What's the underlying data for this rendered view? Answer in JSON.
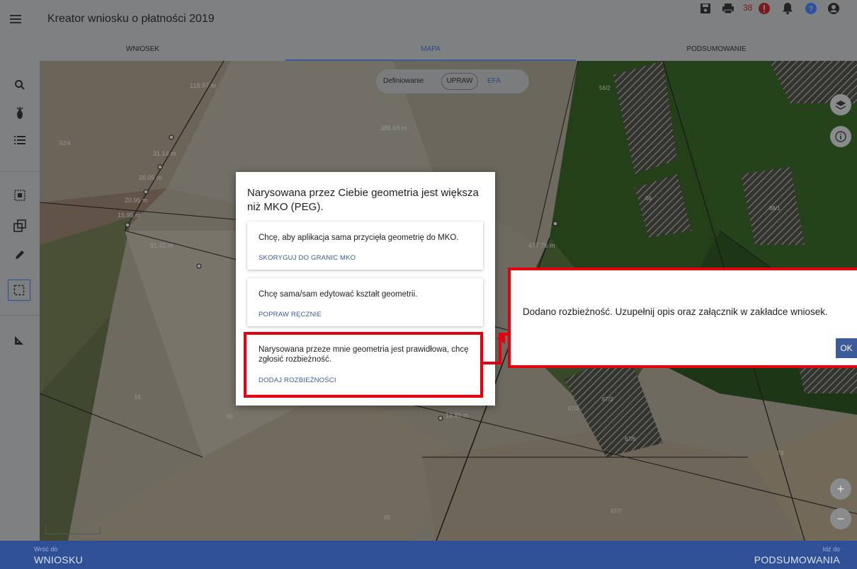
{
  "header": {
    "title": "Kreator wniosku o płatności 2019",
    "error_count": "38",
    "icons": [
      "menu-icon",
      "save-icon",
      "print-icon",
      "error-icon",
      "bell-icon",
      "help-icon",
      "account-icon"
    ]
  },
  "tabs": [
    {
      "label": "WNIOSEK"
    },
    {
      "label": "MAPA"
    },
    {
      "label": "PODSUMOWANIE"
    }
  ],
  "sidebar": {
    "icons": [
      "search-icon",
      "crop-icon",
      "list-icon",
      "select-area-icon",
      "copy-shape-icon",
      "pencil-icon",
      "selection-frame-icon",
      "measure-icon"
    ]
  },
  "map": {
    "mode_toggle": {
      "label": "Definiowanie",
      "option_1": "UPRAW",
      "option_2": "EFA"
    },
    "parcel_labels": [
      "52/4",
      "56/2",
      "66",
      "88/1",
      "67/3",
      "67/2",
      "67/6",
      "67/7",
      "55",
      "60",
      "65",
      "73"
    ],
    "measurements": [
      "118.97 m",
      "31.14 m",
      "26.05 m",
      "20.95 m",
      "15.95 m",
      "81.41 m",
      "386.69 m",
      "477.76 m",
      "13.95 m"
    ],
    "scale": "50 m",
    "zoom_in": "+",
    "zoom_out": "−"
  },
  "dialog": {
    "title": "Narysowana przez Ciebie geometria jest większa niż MKO (PEG).",
    "options": [
      {
        "text": "Chcę, aby aplikacja sama przycięła geometrię do MKO.",
        "action": "SKORYGUJ DO GRANIC MKO"
      },
      {
        "text": "Chcę sama/sam edytować kształt geometrii.",
        "action": "POPRAW RĘCZNIE"
      },
      {
        "text": "Narysowana przeze mnie geometria jest prawidłowa, chcę zgłosić rozbieżność.",
        "action": "DODAJ ROZBIEŻNOŚCI"
      }
    ]
  },
  "snackbar": {
    "message": "Dodano rozbieżność. Uzupełnij opis oraz załącznik w zakładce wniosek.",
    "ok_label": "OK"
  },
  "footer": {
    "back_small": "Wróć do",
    "back_big": "WNIOSKU",
    "next_small": "Idź do",
    "next_big": "PODSUMOWANIA"
  },
  "colors": {
    "accent": "#3b5b9a",
    "highlight": "#e3000f",
    "bottom_bar": "#2f5097"
  }
}
